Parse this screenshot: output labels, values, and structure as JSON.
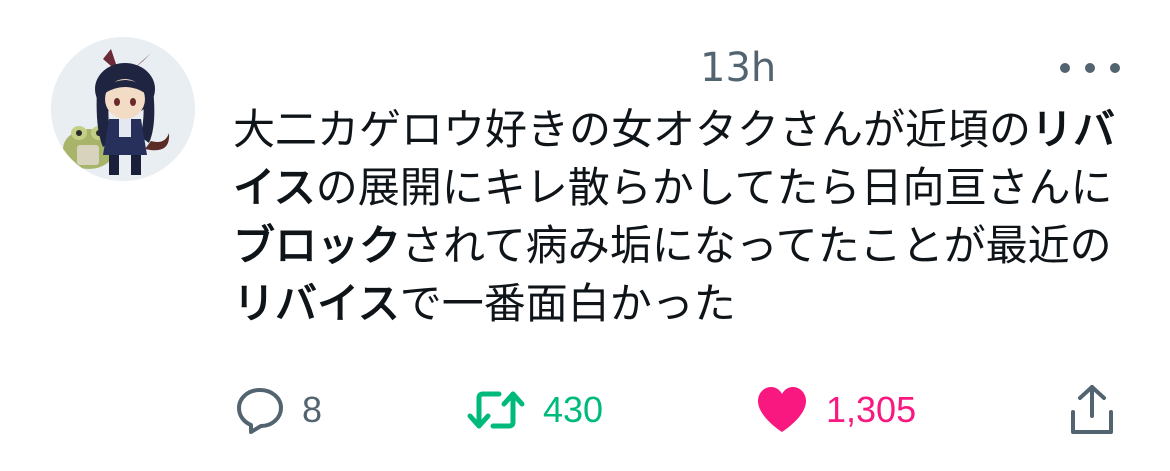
{
  "tweet": {
    "timestamp": "13h",
    "text_segments": [
      {
        "text": "大二カゲロウ好きの女オタクさんが近頃の",
        "bold": false
      },
      {
        "text": "リバイス",
        "bold": true
      },
      {
        "text": "の展開にキレ散らかしてたら日向亘さんに",
        "bold": false
      },
      {
        "text": "ブロック",
        "bold": true
      },
      {
        "text": "されて病み垢になってたことが最近の",
        "bold": false
      },
      {
        "text": "リバイス",
        "bold": true
      },
      {
        "text": "で一番面白かった",
        "bold": false
      }
    ],
    "reply_count": "8",
    "retweet_count": "430",
    "like_count": "1,305"
  },
  "colors": {
    "secondary": "#536471",
    "retweet": "#00ba7c",
    "like": "#f91880",
    "text": "#0f1419"
  },
  "icons": {
    "reply": "reply-bubble-icon",
    "retweet": "retweet-arrows-icon",
    "like": "heart-filled-icon",
    "share": "share-upload-icon",
    "more": "more-dots-icon"
  }
}
